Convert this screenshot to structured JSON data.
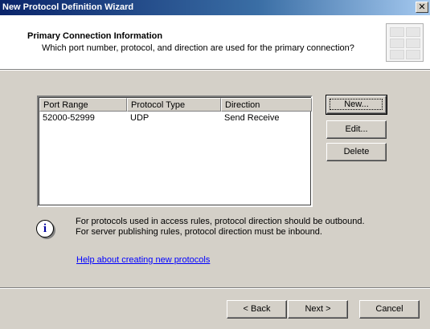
{
  "window": {
    "title": "New Protocol Definition Wizard",
    "close_glyph": "✕"
  },
  "header": {
    "title": "Primary Connection Information",
    "subtitle": "Which port number, protocol, and direction are used for the primary connection?"
  },
  "list": {
    "columns": [
      "Port Range",
      "Protocol Type",
      "Direction"
    ],
    "rows": [
      {
        "port_range": "52000-52999",
        "protocol_type": "UDP",
        "direction": "Send Receive"
      }
    ]
  },
  "side_buttons": {
    "new_label": "New...",
    "edit_label": "Edit...",
    "delete_label": "Delete"
  },
  "info": {
    "icon": "info-icon",
    "line1": "For protocols used in access rules, protocol direction should be outbound.",
    "line2": "For server publishing rules, protocol direction must be inbound.",
    "help_link": "Help about creating new protocols"
  },
  "footer": {
    "back_label": "< Back",
    "next_label": "Next >",
    "cancel_label": "Cancel"
  },
  "colors": {
    "titlebar_start": "#0a246a",
    "titlebar_end": "#a6caf0",
    "face": "#d4d0c8",
    "link": "#0000ff"
  }
}
